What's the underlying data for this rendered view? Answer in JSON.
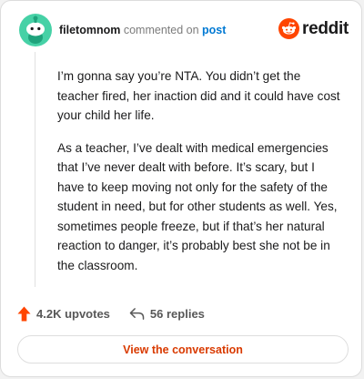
{
  "header": {
    "username": "filetomnom",
    "action_text": "commented on",
    "post_link": "post",
    "avatar_icon": "snoo-avatar-icon"
  },
  "brand": {
    "wordmark": "reddit",
    "logo_icon": "reddit-snoo-icon",
    "accent_color": "#ff4500"
  },
  "comment": {
    "paragraphs": [
      "I’m gonna say you’re NTA. You didn’t get the teacher fired, her inaction did and it could have cost your child her life.",
      "As a teacher, I’ve dealt with medical emergencies that I’ve never dealt with before. It’s scary, but I have to keep moving not only for the safety of the student in need, but for other students as well. Yes, sometimes people freeze, but if that’s her natural reaction to danger, it’s probably best she not be in the classroom."
    ]
  },
  "actions": {
    "upvotes_label": "4.2K upvotes",
    "upvote_icon": "upvote-arrow-icon",
    "replies_label": "56 replies",
    "reply_icon": "reply-arrow-icon"
  },
  "cta": {
    "label": "View the conversation",
    "color": "#d93a00"
  }
}
